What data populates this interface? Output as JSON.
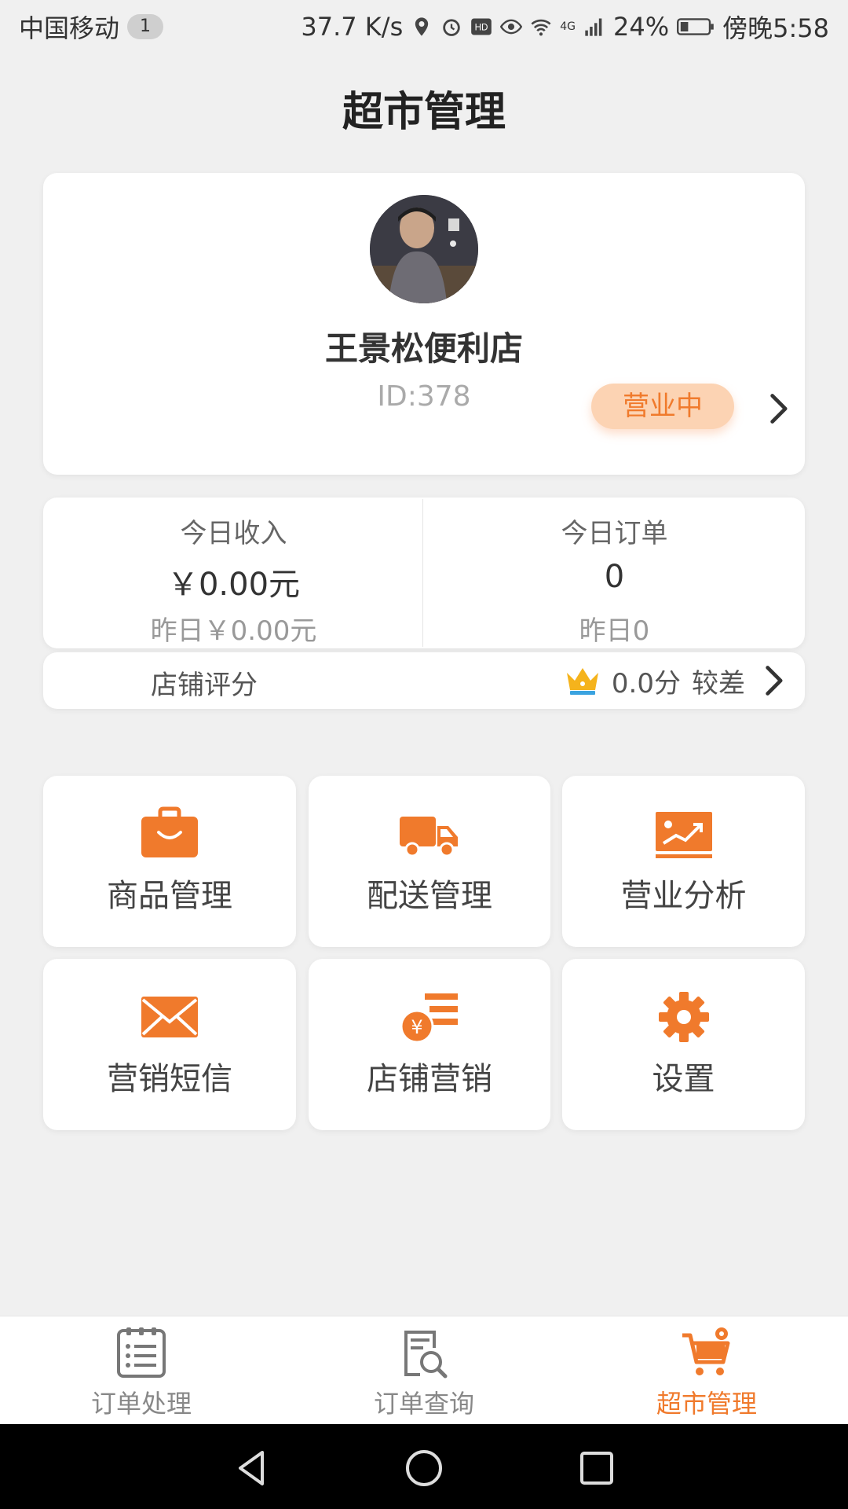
{
  "status_bar": {
    "carrier": "中国移动",
    "sim_slot": "1",
    "net_speed": "37.7 K/s",
    "network": "4G",
    "battery": "24%",
    "time": "傍晚5:58"
  },
  "header": {
    "title": "超市管理"
  },
  "store": {
    "name": "王景松便利店",
    "id": "ID:378",
    "status": "营业中"
  },
  "stats": {
    "income": {
      "label": "今日收入",
      "value": "￥0.00元",
      "yesterday": "昨日￥0.00元"
    },
    "orders": {
      "label": "今日订单",
      "value": "0",
      "yesterday": "昨日0"
    }
  },
  "rating": {
    "label": "店铺评分",
    "score": "0.0分",
    "level": "较差"
  },
  "menu": [
    {
      "label": "商品管理",
      "icon": "briefcase-icon"
    },
    {
      "label": "配送管理",
      "icon": "truck-icon"
    },
    {
      "label": "营业分析",
      "icon": "chart-icon"
    },
    {
      "label": "营销短信",
      "icon": "envelope-icon"
    },
    {
      "label": "店铺营销",
      "icon": "coin-list-icon"
    },
    {
      "label": "设置",
      "icon": "gear-icon"
    }
  ],
  "bottom_nav": [
    {
      "label": "订单处理",
      "icon": "order-list-icon",
      "active": false
    },
    {
      "label": "订单查询",
      "icon": "order-search-icon",
      "active": false
    },
    {
      "label": "超市管理",
      "icon": "cart-icon",
      "active": true
    }
  ],
  "colors": {
    "accent": "#f07a2c",
    "pill_bg": "#fcd3b3",
    "background": "#f0f0f0"
  }
}
